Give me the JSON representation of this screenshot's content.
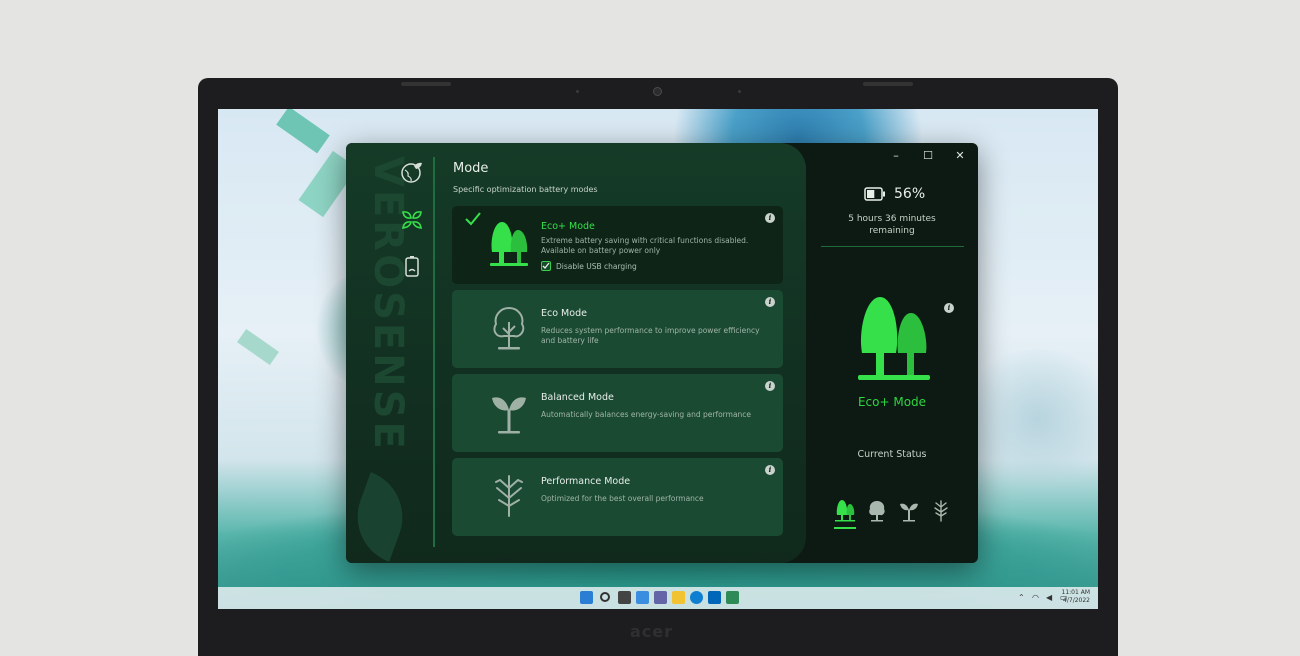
{
  "brand": {
    "vertical_text": "VEROSENSE",
    "laptop_logo": "acer"
  },
  "main": {
    "title": "Mode",
    "subtitle": "Specific optimization battery modes",
    "nav_icons": [
      "globe-leaf-icon",
      "leaves-icon",
      "battery-icon"
    ],
    "modes": [
      {
        "name": "Eco+ Mode",
        "description": "Extreme battery saving with critical functions disabled. Available on battery power only",
        "icon": "twin-trees-icon",
        "selected": true
      },
      {
        "name": "Eco Mode",
        "description": "Reduces system performance to improve power efficiency and battery life",
        "icon": "tree-icon",
        "selected": false
      },
      {
        "name": "Balanced Mode",
        "description": "Automatically balances energy-saving and performance",
        "icon": "sprout-icon",
        "selected": false
      },
      {
        "name": "Performance Mode",
        "description": "Optimized for the best overall performance",
        "icon": "bare-branch-icon",
        "selected": false
      }
    ],
    "usb_option": {
      "label": "Disable USB charging",
      "checked": true
    }
  },
  "status": {
    "battery_percent": "56%",
    "battery_level": 0.56,
    "remaining_line1": "5 hours 36 minutes",
    "remaining_line2": "remaining",
    "current_mode": "Eco+ Mode",
    "current_status_label": "Current Status",
    "mode_icons": [
      "twin-trees-icon",
      "tree-icon",
      "sprout-icon",
      "bare-branch-icon"
    ],
    "active_mode_index": 0
  },
  "window_controls": {
    "minimize": "–",
    "maximize": "☐",
    "close": "✕"
  },
  "taskbar": {
    "time": "11:01 AM",
    "date": "4/7/2022"
  },
  "colors": {
    "accent": "#35e04a",
    "panel_bg": "#153b27",
    "card_bg": "#1b4a33",
    "active_card_bg": "#0e2417"
  }
}
